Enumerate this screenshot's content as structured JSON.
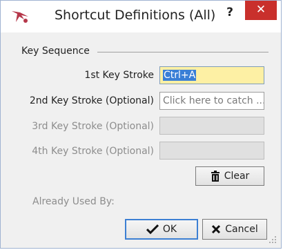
{
  "window": {
    "title": "Shortcut Definitions (All)",
    "help_label": "?",
    "close_label": "✕"
  },
  "group": {
    "title": "Key Sequence"
  },
  "fields": [
    {
      "label": "1st Key Stroke",
      "value": "Ctrl+A",
      "placeholder": "",
      "state": "focused"
    },
    {
      "label": "2nd Key Stroke (Optional)",
      "value": "",
      "placeholder": "Click here to catch ...",
      "state": "enabled"
    },
    {
      "label": "3rd Key Stroke (Optional)",
      "value": "",
      "placeholder": "",
      "state": "disabled"
    },
    {
      "label": "4th Key Stroke (Optional)",
      "value": "",
      "placeholder": "",
      "state": "disabled"
    }
  ],
  "buttons": {
    "clear": "Clear",
    "ok": "OK",
    "cancel": "Cancel"
  },
  "already_used_by": "Already Used By:",
  "colors": {
    "close_button": "#c9302c",
    "focused_field": "#fdf0a4",
    "selection": "#3a7fd6",
    "default_button_border": "#3c7fd3",
    "app_icon": "#b5374a"
  },
  "icons": {
    "app": "app-logo-icon",
    "clear": "trash-can-icon",
    "ok": "check-icon",
    "cancel": "x-icon",
    "grip": "resize-grip-icon"
  }
}
